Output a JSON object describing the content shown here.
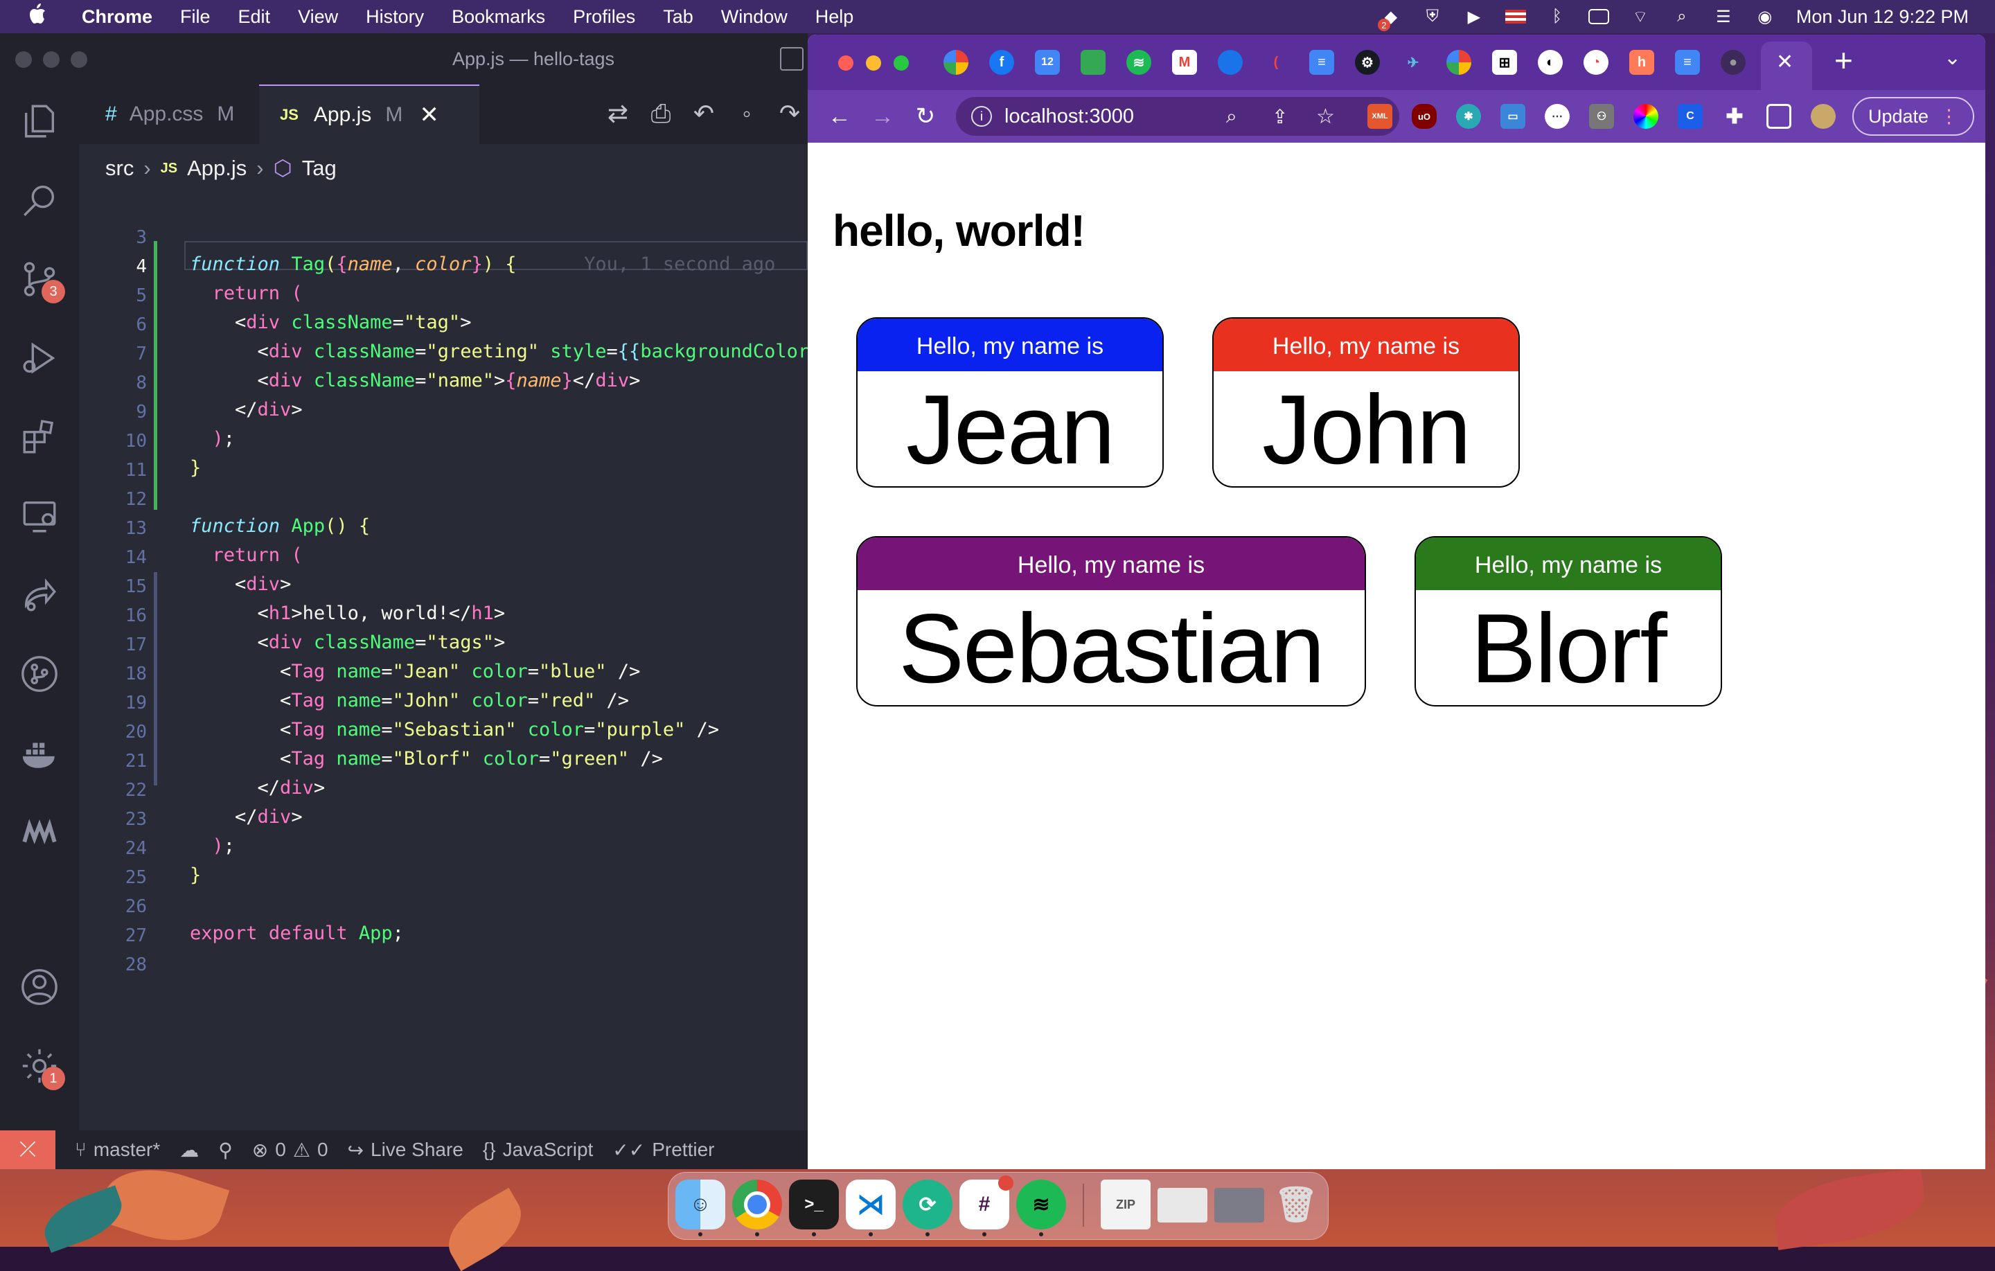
{
  "menubar": {
    "app": "Chrome",
    "items": [
      "File",
      "Edit",
      "View",
      "History",
      "Bookmarks",
      "Profiles",
      "Tab",
      "Window",
      "Help"
    ],
    "clock": "Mon Jun 12  9:22 PM",
    "dropbox_badge": "2"
  },
  "vscode": {
    "title": "App.js — hello-tags",
    "tabs": [
      {
        "icon": "#",
        "label": "App.css",
        "mod": "M"
      },
      {
        "icon": "JS",
        "label": "App.js",
        "mod": "M"
      }
    ],
    "breadcrumb": {
      "root": "src",
      "file_icon": "JS",
      "file": "App.js",
      "symbol": "Tag"
    },
    "scm_badge": "3",
    "settings_badge": "1",
    "ghost_text": "You, 1 second ago",
    "line_numbers": [
      "3",
      "4",
      "5",
      "6",
      "7",
      "8",
      "9",
      "10",
      "11",
      "12",
      "13",
      "14",
      "15",
      "16",
      "17",
      "18",
      "19",
      "20",
      "21",
      "22",
      "23",
      "24",
      "25",
      "26",
      "27",
      "28"
    ],
    "status": {
      "branch": "master*",
      "errors": "0",
      "warnings": "0",
      "live_share": "Live Share",
      "language": "JavaScript",
      "prettier": "Prettier"
    }
  },
  "chrome": {
    "url": "localhost:3000",
    "update_label": "Update",
    "new_tab": "+"
  },
  "page": {
    "heading": "hello, world!",
    "tags": [
      {
        "greeting": "Hello, my name is",
        "name": "Jean",
        "color": "#0a22f0"
      },
      {
        "greeting": "Hello, my name is",
        "name": "John",
        "color": "#e8311f"
      },
      {
        "greeting": "Hello, my name is",
        "name": "Sebastian",
        "color": "#761478"
      },
      {
        "greeting": "Hello, my name is",
        "name": "Blorf",
        "color": "#2a7a1c"
      }
    ]
  },
  "colors": {
    "editor_bg": "#282a36",
    "chrome_frame": "#5b2f9b",
    "remote_indicator": "#e8655a"
  }
}
